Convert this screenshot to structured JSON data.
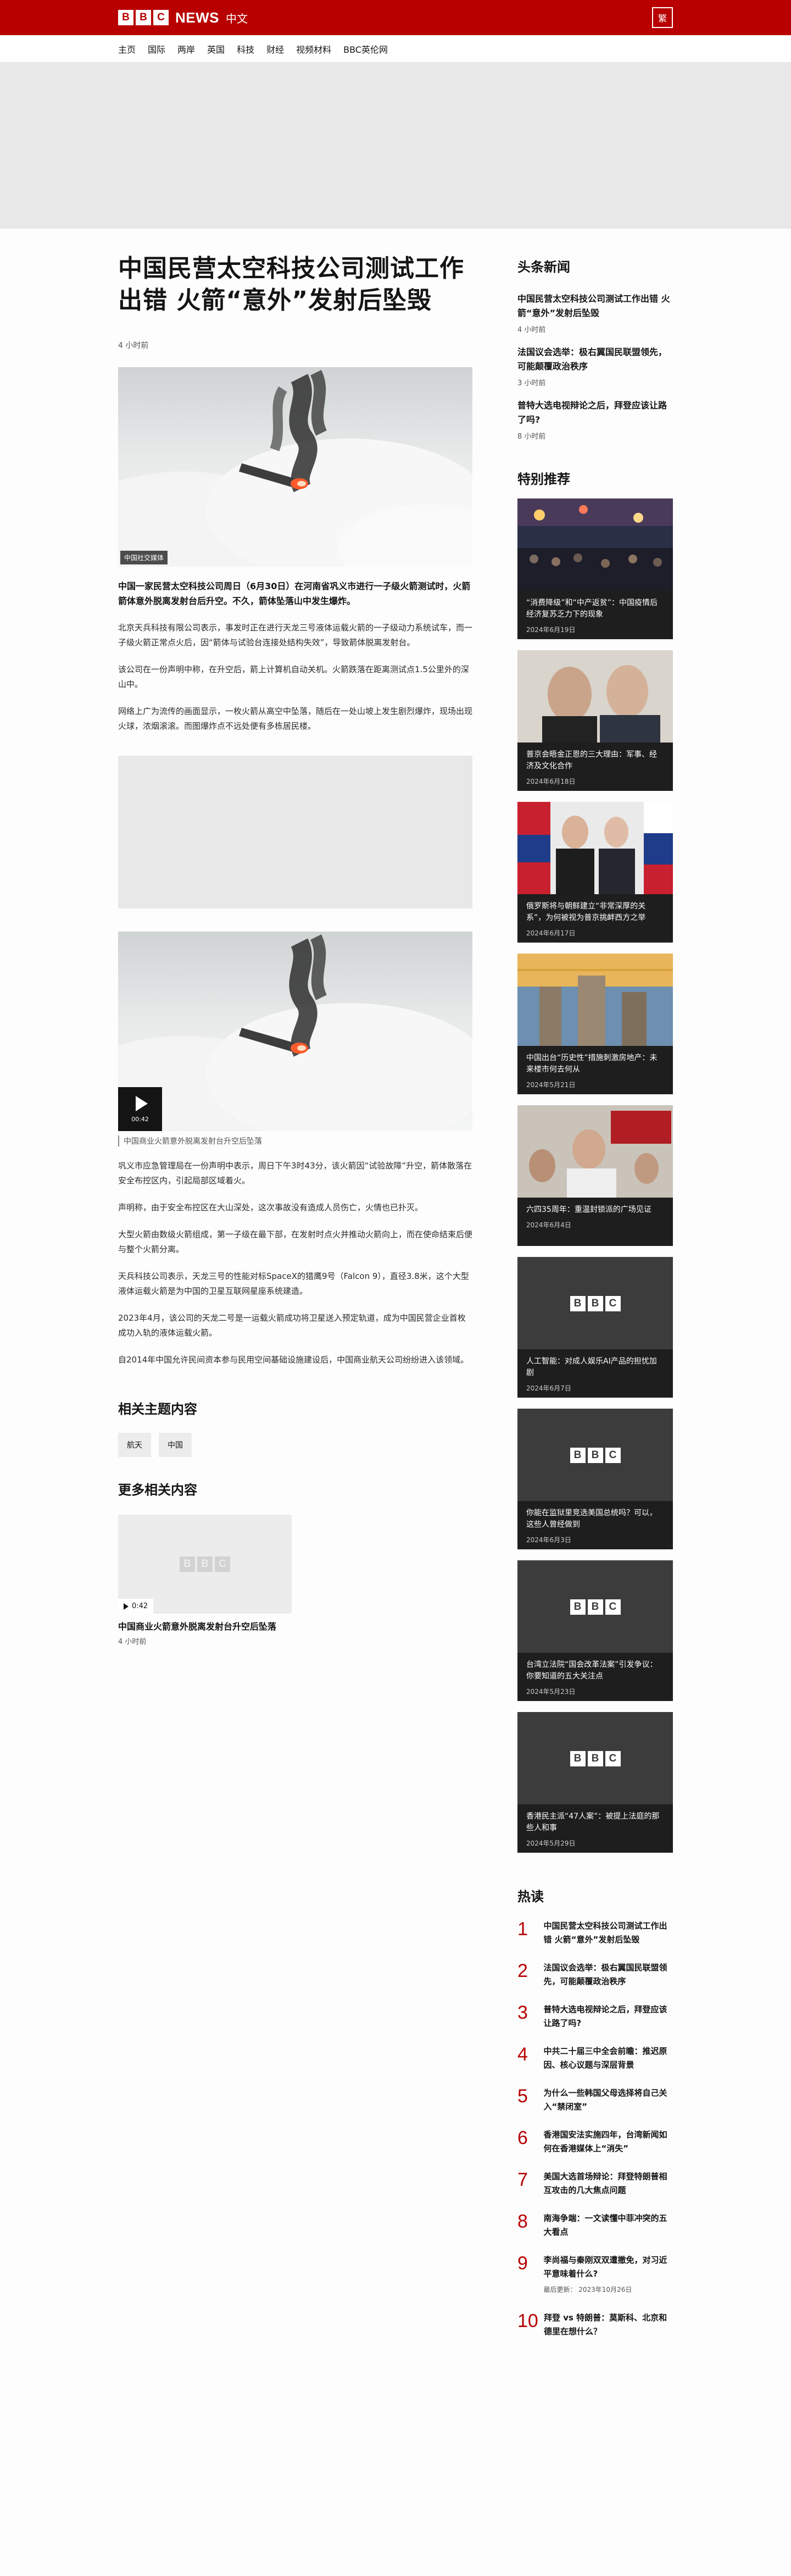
{
  "masthead": {
    "logo_letters": [
      "B",
      "B",
      "C"
    ],
    "news_label": "NEWS",
    "zh_label": "中文",
    "lang_button": "繁"
  },
  "nav": [
    "主页",
    "国际",
    "两岸",
    "英国",
    "科技",
    "财经",
    "视频材料",
    "BBC英伦网"
  ],
  "article": {
    "title": "中国民营太空科技公司测试工作出错 火箭“意外”发射后坠毁",
    "time": "4 小时前",
    "hero_credit": "中国社交媒体",
    "lead": "中国一家民营太空科技公司周日（6月30日）在河南省巩义市进行一子级火箭测试时，火箭箭体意外脱离发射台后升空。不久，箭体坠落山中发生爆炸。",
    "paras_a": [
      "北京天兵科技有限公司表示，事发时正在进行天龙三号液体运载火箭的一子级动力系统试车，而一子级火箭正常点火后，因“箭体与试验台连接处结构失效”，导致箭体脱离发射台。",
      "该公司在一份声明中称，在升空后，箭上计算机自动关机。火箭跌落在距离测试点1.5公里外的深山中。",
      "网络上广为流传的画面显示，一枚火箭从高空中坠落，随后在一处山坡上发生剧烈爆炸，现场出现火球，浓烟滚滚。而图爆炸点不远处便有多栋居民楼。"
    ],
    "video_duration": "00:42",
    "video_caption": "中国商业火箭意外脱离发射台升空后坠落",
    "paras_b": [
      "巩义市应急管理局在一份声明中表示，周日下午3时43分，该火箭因“试验故障”升空，箭体散落在安全布控区内，引起局部区域着火。",
      "声明称，由于安全布控区在大山深处，这次事故没有造成人员伤亡，火情也已扑灭。",
      "大型火箭由数级火箭组成，第一子级在最下部，在发射时点火并推动火箭向上，而在使命结束后便与整个火箭分离。",
      "天兵科技公司表示，天龙三号的性能对标SpaceX的猎鹰9号（Falcon 9），直径3.8米，这个大型液体运载火箭是为中国的卫星互联网星座系统建造。",
      "2023年4月，该公司的天龙二号是一运载火箭成功将卫星送入预定轨道，成为中国民营企业首枚成功入轨的液体运载火箭。",
      "自2014年中国允许民间资本参与民用空间基础设施建设后，中国商业航天公司纷纷进入该领域。"
    ],
    "related_heading": "相关主题内容",
    "tags": [
      "航天",
      "中国"
    ],
    "more_heading": "更多相关内容",
    "more_card": {
      "duration": "0:42",
      "title": "中国商业火箭意外脱离发射台升空后坠落",
      "time": "4 小时前"
    }
  },
  "sidebar": {
    "top_heading": "头条新闻",
    "top": [
      {
        "title": "中国民营太空科技公司测试工作出错 火箭“意外”发射后坠毁",
        "time": "4 小时前"
      },
      {
        "title": "法国议会选举：极右翼国民联盟领先，可能颠覆政治秩序",
        "time": "3 小时前"
      },
      {
        "title": "普特大选电视辩论之后，拜登应该让路了吗?",
        "time": "8 小时前"
      }
    ],
    "feature_heading": "特别推荐",
    "features": [
      {
        "title": "“消费降级”和“中产返贫”：中国疫情后经济复苏乏力下的现象",
        "date": "2024年6月19日"
      },
      {
        "title": "普京会晤金正恩的三大理由：军事、经济及文化合作",
        "date": "2024年6月18日"
      },
      {
        "title": "俄罗斯将与朝鲜建立“非常深厚的关系”，为何被视为普京挑衅西方之举",
        "date": "2024年6月17日"
      },
      {
        "title": "中国出台“历史性”措施刺激房地产：未来楼市何去何从",
        "date": "2024年5月21日"
      },
      {
        "title": "六四35周年：重温封锁派的广场见证",
        "date": "2024年6月4日"
      },
      {
        "title": "人工智能：对成人娱乐AI产品的担忧加剧",
        "date": "2024年6月7日"
      },
      {
        "title": "你能在监狱里竞选美国总统吗？可以，这些人曾经做到",
        "date": "2024年6月3日"
      },
      {
        "title": "台湾立法院“国会改革法案”引发争议：你要知道的五大关注点",
        "date": "2024年5月23日"
      },
      {
        "title": "香港民主派“47人案”：被提上法庭的那些人和事",
        "date": "2024年5月29日"
      }
    ],
    "most_heading": "热读",
    "most": [
      {
        "n": "1",
        "title": "中国民营太空科技公司测试工作出错 火箭“意外”发射后坠毁"
      },
      {
        "n": "2",
        "title": "法国议会选举：极右翼国民联盟领先，可能颠覆政治秩序"
      },
      {
        "n": "3",
        "title": "普特大选电视辩论之后，拜登应该让路了吗?"
      },
      {
        "n": "4",
        "title": "中共二十届三中全会前瞻：推迟原因、核心议题与深层背景"
      },
      {
        "n": "5",
        "title": "为什么一些韩国父母选择将自己关入“禁闭室”"
      },
      {
        "n": "6",
        "title": "香港国安法实施四年，台湾新闻如何在香港媒体上“消失”"
      },
      {
        "n": "7",
        "title": "美国大选首场辩论：拜登特朗普相互攻击的几大焦点问题"
      },
      {
        "n": "8",
        "title": "南海争端：一文读懂中菲冲突的五大看点"
      },
      {
        "n": "9",
        "title": "李尚福与秦刚双双遭撤免，对习近平意味着什么?",
        "updated": "最后更新：  2023年10月26日"
      },
      {
        "n": "10",
        "title": "拜登 vs 特朗普：莫斯科、北京和德里在想什么？"
      }
    ]
  }
}
